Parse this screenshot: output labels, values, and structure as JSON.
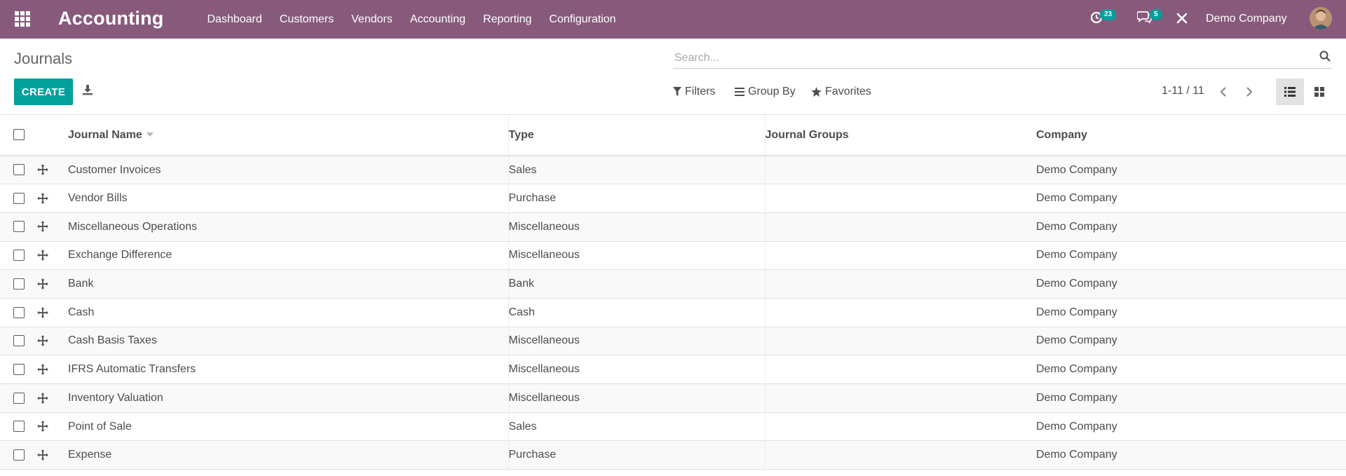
{
  "navbar": {
    "brand": "Accounting",
    "menu": [
      "Dashboard",
      "Customers",
      "Vendors",
      "Accounting",
      "Reporting",
      "Configuration"
    ],
    "activity_count": "23",
    "message_count": "5",
    "company": "Demo Company",
    "color": "#875a7b"
  },
  "control_panel": {
    "breadcrumb": "Journals",
    "search_placeholder": "Search...",
    "create_label": "CREATE",
    "filters_label": "Filters",
    "groupby_label": "Group By",
    "favorites_label": "Favorites",
    "pager": "1-11 / 11",
    "accent": "#00a09d"
  },
  "table": {
    "columns": [
      "Journal Name",
      "Type",
      "Journal Groups",
      "Company"
    ],
    "rows": [
      {
        "name": "Customer Invoices",
        "type": "Sales",
        "groups": "",
        "company": "Demo Company"
      },
      {
        "name": "Vendor Bills",
        "type": "Purchase",
        "groups": "",
        "company": "Demo Company"
      },
      {
        "name": "Miscellaneous Operations",
        "type": "Miscellaneous",
        "groups": "",
        "company": "Demo Company"
      },
      {
        "name": "Exchange Difference",
        "type": "Miscellaneous",
        "groups": "",
        "company": "Demo Company"
      },
      {
        "name": "Bank",
        "type": "Bank",
        "groups": "",
        "company": "Demo Company"
      },
      {
        "name": "Cash",
        "type": "Cash",
        "groups": "",
        "company": "Demo Company"
      },
      {
        "name": "Cash Basis Taxes",
        "type": "Miscellaneous",
        "groups": "",
        "company": "Demo Company"
      },
      {
        "name": "IFRS Automatic Transfers",
        "type": "Miscellaneous",
        "groups": "",
        "company": "Demo Company"
      },
      {
        "name": "Inventory Valuation",
        "type": "Miscellaneous",
        "groups": "",
        "company": "Demo Company"
      },
      {
        "name": "Point of Sale",
        "type": "Sales",
        "groups": "",
        "company": "Demo Company"
      },
      {
        "name": "Expense",
        "type": "Purchase",
        "groups": "",
        "company": "Demo Company"
      }
    ]
  }
}
